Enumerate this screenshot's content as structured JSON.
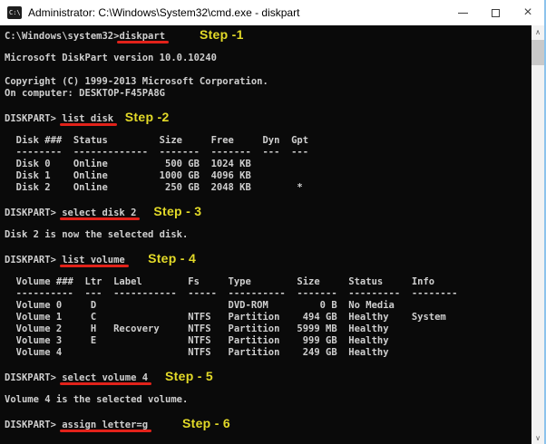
{
  "window": {
    "title": "Administrator: C:\\Windows\\System32\\cmd.exe - diskpart",
    "icon_text": "C:\\",
    "controls": {
      "close_glyph": "×"
    }
  },
  "colors": {
    "console_bg": "#0a0a0a",
    "console_text": "#cfcfcf",
    "underline_red": "#e2221a",
    "step_yellow": "#e3da28",
    "titlebar_bg": "#ffffff",
    "accent_border": "#8cc3ec",
    "scrollbar_track": "#f2f2f2",
    "scrollbar_thumb": "#c9c9c9"
  },
  "scrollbar": {
    "up_glyph": "∧",
    "down_glyph": "∨"
  },
  "console": {
    "lines": [
      {
        "segments": [
          {
            "text": "C:\\Windows\\system32>",
            "type": "plain"
          },
          {
            "text": "diskpart",
            "type": "cmd"
          },
          {
            "text": "      ",
            "type": "plain"
          },
          {
            "text": "Step -1",
            "type": "step"
          }
        ]
      },
      {
        "segments": [
          {
            "text": "",
            "type": "plain"
          }
        ]
      },
      {
        "segments": [
          {
            "text": "Microsoft DiskPart version 10.0.10240",
            "type": "plain"
          }
        ]
      },
      {
        "segments": [
          {
            "text": "",
            "type": "plain"
          }
        ]
      },
      {
        "segments": [
          {
            "text": "Copyright (C) 1999-2013 Microsoft Corporation.",
            "type": "plain"
          }
        ]
      },
      {
        "segments": [
          {
            "text": "On computer: DESKTOP-F45PA8G",
            "type": "plain"
          }
        ]
      },
      {
        "segments": [
          {
            "text": "",
            "type": "plain"
          }
        ]
      },
      {
        "segments": [
          {
            "text": "DISKPART> ",
            "type": "plain"
          },
          {
            "text": "list disk",
            "type": "cmd"
          },
          {
            "text": "  ",
            "type": "plain"
          },
          {
            "text": "Step -2",
            "type": "step"
          }
        ]
      },
      {
        "segments": [
          {
            "text": "",
            "type": "plain"
          }
        ]
      },
      {
        "segments": [
          {
            "text": "  Disk ###  Status         Size     Free     Dyn  Gpt",
            "type": "plain"
          }
        ]
      },
      {
        "segments": [
          {
            "text": "  --------  -------------  -------  -------  ---  ---",
            "type": "plain"
          }
        ]
      },
      {
        "segments": [
          {
            "text": "  Disk 0    Online          500 GB  1024 KB",
            "type": "plain"
          }
        ]
      },
      {
        "segments": [
          {
            "text": "  Disk 1    Online         1000 GB  4096 KB",
            "type": "plain"
          }
        ]
      },
      {
        "segments": [
          {
            "text": "  Disk 2    Online          250 GB  2048 KB        *",
            "type": "plain"
          }
        ]
      },
      {
        "segments": [
          {
            "text": "",
            "type": "plain"
          }
        ]
      },
      {
        "segments": [
          {
            "text": "DISKPART> ",
            "type": "plain"
          },
          {
            "text": "select disk 2",
            "type": "cmd"
          },
          {
            "text": "   ",
            "type": "plain"
          },
          {
            "text": "Step - 3",
            "type": "step"
          }
        ]
      },
      {
        "segments": [
          {
            "text": "",
            "type": "plain"
          }
        ]
      },
      {
        "segments": [
          {
            "text": "Disk 2 is now the selected disk.",
            "type": "plain"
          }
        ]
      },
      {
        "segments": [
          {
            "text": "",
            "type": "plain"
          }
        ]
      },
      {
        "segments": [
          {
            "text": "DISKPART> ",
            "type": "plain"
          },
          {
            "text": "list volume",
            "type": "cmd"
          },
          {
            "text": "    ",
            "type": "plain"
          },
          {
            "text": "Step - 4",
            "type": "step"
          }
        ]
      },
      {
        "segments": [
          {
            "text": "",
            "type": "plain"
          }
        ]
      },
      {
        "segments": [
          {
            "text": "  Volume ###  Ltr  Label        Fs     Type        Size     Status     Info",
            "type": "plain"
          }
        ]
      },
      {
        "segments": [
          {
            "text": "  ----------  ---  -----------  -----  ----------  -------  ---------  --------",
            "type": "plain"
          }
        ]
      },
      {
        "segments": [
          {
            "text": "  Volume 0     D                       DVD-ROM         0 B  No Media",
            "type": "plain"
          }
        ]
      },
      {
        "segments": [
          {
            "text": "  Volume 1     C                NTFS   Partition    494 GB  Healthy    System",
            "type": "plain"
          }
        ]
      },
      {
        "segments": [
          {
            "text": "  Volume 2     H   Recovery     NTFS   Partition   5999 MB  Healthy",
            "type": "plain"
          }
        ]
      },
      {
        "segments": [
          {
            "text": "  Volume 3     E                NTFS   Partition    999 GB  Healthy",
            "type": "plain"
          }
        ]
      },
      {
        "segments": [
          {
            "text": "  Volume 4                      NTFS   Partition    249 GB  Healthy",
            "type": "plain"
          }
        ]
      },
      {
        "segments": [
          {
            "text": "",
            "type": "plain"
          }
        ]
      },
      {
        "segments": [
          {
            "text": "DISKPART> ",
            "type": "plain"
          },
          {
            "text": "select volume 4",
            "type": "cmd"
          },
          {
            "text": "   ",
            "type": "plain"
          },
          {
            "text": "Step - 5",
            "type": "step"
          }
        ]
      },
      {
        "segments": [
          {
            "text": "",
            "type": "plain"
          }
        ]
      },
      {
        "segments": [
          {
            "text": "Volume 4 is the selected volume.",
            "type": "plain"
          }
        ]
      },
      {
        "segments": [
          {
            "text": "",
            "type": "plain"
          }
        ]
      },
      {
        "segments": [
          {
            "text": "DISKPART> ",
            "type": "plain"
          },
          {
            "text": "assign letter=g",
            "type": "cmd"
          },
          {
            "text": "      ",
            "type": "plain"
          },
          {
            "text": "Step - 6",
            "type": "step"
          }
        ]
      }
    ]
  }
}
